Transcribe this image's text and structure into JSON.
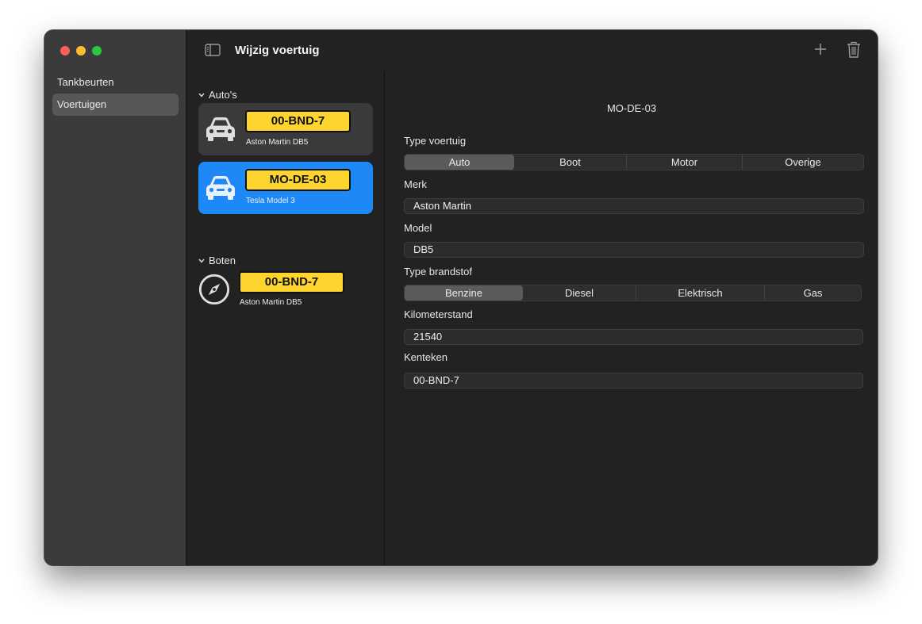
{
  "window": {
    "title": "Wijzig voertuig"
  },
  "sidebar": {
    "items": [
      {
        "label": "Tankbeurten",
        "selected": false
      },
      {
        "label": "Voertuigen",
        "selected": true
      }
    ]
  },
  "list": {
    "sections": [
      {
        "title": "Auto's",
        "items": [
          {
            "plate": "00-BND-7",
            "name": "Aston Martin DB5",
            "icon": "car-icon",
            "selected": false
          },
          {
            "plate": "MO-DE-03",
            "name": "Tesla Model 3",
            "icon": "car-icon",
            "selected": true
          }
        ]
      },
      {
        "title": "Boten",
        "items": [
          {
            "plate": "00-BND-7",
            "name": "Aston Martin DB5",
            "icon": "compass-icon",
            "selected": false
          }
        ]
      }
    ]
  },
  "detail": {
    "header": "MO-DE-03",
    "vehicle_type": {
      "label": "Type voertuig",
      "options": [
        "Auto",
        "Boot",
        "Motor",
        "Overige"
      ],
      "selected": "Auto"
    },
    "brand": {
      "label": "Merk",
      "value": "Aston Martin"
    },
    "model": {
      "label": "Model",
      "value": "DB5"
    },
    "fuel_type": {
      "label": "Type brandstof",
      "options": [
        "Benzine",
        "Diesel",
        "Elektrisch",
        "Gas"
      ],
      "selected": "Benzine"
    },
    "mileage": {
      "label": "Kilometerstand",
      "value": "21540"
    },
    "plate": {
      "label": "Kenteken",
      "value": "00-BND-7"
    }
  },
  "colors": {
    "accent": "#1e88f7",
    "plate": "#fed42f",
    "background": "#222222",
    "sidebar": "#3b3b3b"
  }
}
